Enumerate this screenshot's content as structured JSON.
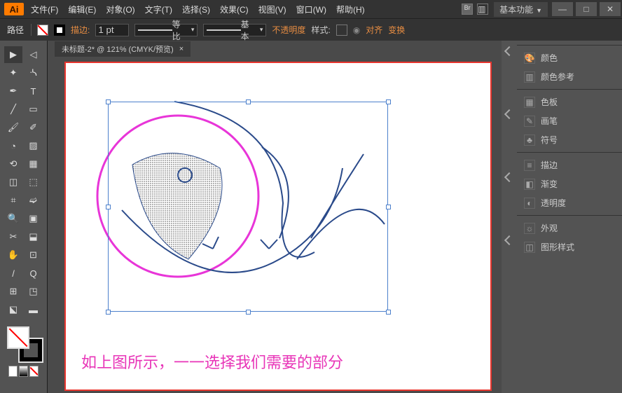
{
  "logo": "Ai",
  "menu": [
    "文件(F)",
    "编辑(E)",
    "对象(O)",
    "文字(T)",
    "选择(S)",
    "效果(C)",
    "视图(V)",
    "窗口(W)",
    "帮助(H)"
  ],
  "workspace": "基本功能",
  "secondary": {
    "left_label": "路径",
    "stroke_label": "描边:",
    "stroke_val": "1 pt",
    "profile_val": "等比",
    "brush_val": "基本",
    "opacity_label": "不透明度",
    "style_label": "样式:",
    "align_label": "对齐",
    "transform_label": "变换"
  },
  "doc_tab": "未标题-2* @ 121% (CMYK/预览)",
  "caption": "如上图所示，一一选择我们需要的部分",
  "panels": {
    "g1": [
      "颜色",
      "颜色参考"
    ],
    "g2": [
      "色板",
      "画笔",
      "符号"
    ],
    "g3": [
      "描边",
      "渐变",
      "透明度"
    ],
    "g4": [
      "外观",
      "图形样式"
    ]
  },
  "panel_icons": {
    "颜色": "🎨",
    "颜色参考": "▥",
    "色板": "▦",
    "画笔": "✎",
    "符号": "♣",
    "描边": "≡",
    "渐变": "◧",
    "透明度": "◐",
    "外观": "☼",
    "图形样式": "◫"
  }
}
